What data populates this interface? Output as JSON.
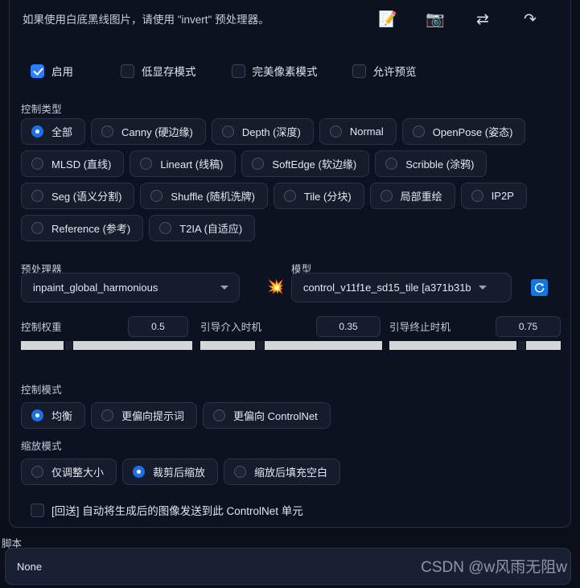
{
  "hint": {
    "text": "如果使用白底黑线图片，请使用 \"invert\" 预处理器。",
    "icons": [
      {
        "name": "memo-icon",
        "glyph": "📝"
      },
      {
        "name": "camera-icon",
        "glyph": "📷"
      },
      {
        "name": "swap-icon",
        "glyph": "⇄"
      },
      {
        "name": "send-icon",
        "glyph": "↷"
      }
    ]
  },
  "checkboxes": [
    {
      "label": "启用",
      "checked": true
    },
    {
      "label": "低显存模式",
      "checked": false
    },
    {
      "label": "完美像素模式",
      "checked": false
    },
    {
      "label": "允许预览",
      "checked": false
    }
  ],
  "control_type": {
    "label": "控制类型",
    "options": [
      {
        "label": "全部",
        "selected": true
      },
      {
        "label": "Canny (硬边缘)",
        "selected": false
      },
      {
        "label": "Depth (深度)",
        "selected": false
      },
      {
        "label": "Normal",
        "selected": false
      },
      {
        "label": "OpenPose (姿态)",
        "selected": false
      },
      {
        "label": "MLSD (直线)",
        "selected": false
      },
      {
        "label": "Lineart (线稿)",
        "selected": false
      },
      {
        "label": "SoftEdge (软边缘)",
        "selected": false
      },
      {
        "label": "Scribble (涂鸦)",
        "selected": false
      },
      {
        "label": "Seg (语义分割)",
        "selected": false
      },
      {
        "label": "Shuffle (随机洗牌)",
        "selected": false
      },
      {
        "label": "Tile (分块)",
        "selected": false
      },
      {
        "label": "局部重绘",
        "selected": false
      },
      {
        "label": "IP2P",
        "selected": false
      },
      {
        "label": "Reference (参考)",
        "selected": false
      },
      {
        "label": "T2IA (自适应)",
        "selected": false
      }
    ]
  },
  "preprocessor": {
    "label": "预处理器",
    "value": "inpaint_global_harmonious"
  },
  "model": {
    "label": "模型",
    "value": "control_v11f1e_sd15_tile [a371b31b"
  },
  "run_button": {
    "name": "run-preprocessor",
    "glyph": "💥"
  },
  "refresh_button": {
    "name": "refresh-models",
    "glyph": "⟳",
    "color": "#1178e0"
  },
  "sliders": [
    {
      "label": "控制权重",
      "value": "0.5",
      "fraction": 0.26
    },
    {
      "label": "引导介入时机",
      "value": "0.35",
      "fraction": 0.35
    },
    {
      "label": "引导终止时机",
      "value": "0.75",
      "fraction": 0.75
    }
  ],
  "control_mode": {
    "label": "控制模式",
    "options": [
      {
        "label": "均衡",
        "selected": true
      },
      {
        "label": "更偏向提示词",
        "selected": false
      },
      {
        "label": "更偏向 ControlNet",
        "selected": false
      }
    ]
  },
  "resize_mode": {
    "label": "缩放模式",
    "options": [
      {
        "label": "仅调整大小",
        "selected": false
      },
      {
        "label": "裁剪后缩放",
        "selected": true
      },
      {
        "label": "缩放后填充空白",
        "selected": false
      }
    ]
  },
  "loopback": {
    "label": "[回送] 自动将生成后的图像发送到此 ControlNet 单元",
    "checked": false
  },
  "script": {
    "label": "脚本",
    "value": "None"
  },
  "watermark": "CSDN @w风雨无阻w"
}
